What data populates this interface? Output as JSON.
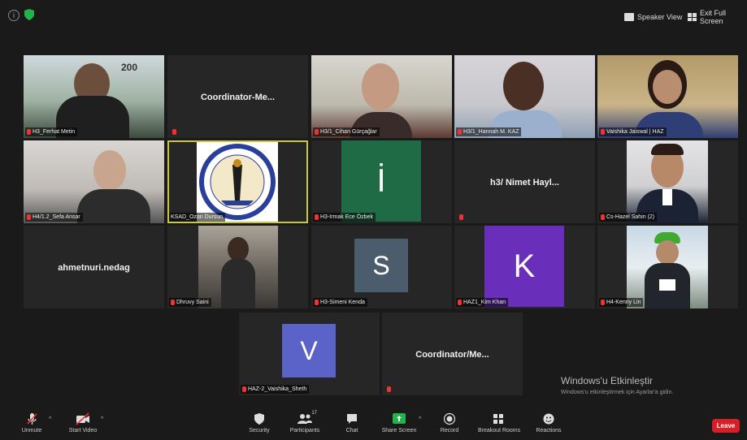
{
  "topbar": {
    "speaker_view": "Speaker View",
    "exit_full_screen": "Exit Full Screen"
  },
  "tiles": [
    {
      "name": "H3_Ferhat Metin",
      "big": "",
      "type": "video"
    },
    {
      "name": "",
      "big": "Coordinator-Me...",
      "type": "name"
    },
    {
      "name": "H3/1_Cihan Gürçağlar",
      "big": "",
      "type": "video"
    },
    {
      "name": "H3/1_Hannah M. KAZ",
      "big": "",
      "type": "video"
    },
    {
      "name": "Vaishika Jaiswal | HAZ",
      "big": "",
      "type": "video"
    },
    {
      "name": "H4/1.2_Sefa Ansar",
      "big": "",
      "type": "video"
    },
    {
      "name": "KSAD_Ozan Dursun",
      "big": "",
      "type": "logo"
    },
    {
      "name": "H3-Irmak Ece Özbek",
      "big": "",
      "type": "avatar",
      "letter": "İ",
      "color": "#1f6b46"
    },
    {
      "name": "",
      "big": "h3/ Nimet Hayl...",
      "type": "name"
    },
    {
      "name": "Cs-Hazel Sahin (2)",
      "big": "",
      "type": "video"
    },
    {
      "name": "",
      "big": "ahmetnuri.nedag",
      "type": "name"
    },
    {
      "name": "Dhruvy Saini",
      "big": "",
      "type": "video"
    },
    {
      "name": "H3-Simeni Kenda",
      "big": "",
      "type": "avatar",
      "letter": "S",
      "color": "#4b5d6c"
    },
    {
      "name": "HAZ1_Kim Khan",
      "big": "",
      "type": "avatar",
      "letter": "K",
      "color": "#6a2fba"
    },
    {
      "name": "H4-Kenny Lin",
      "big": "",
      "type": "video"
    },
    {
      "name": "HAZ-2_Vaishika_Sheth",
      "big": "",
      "type": "avatar",
      "letter": "V",
      "color": "#5b63c8"
    },
    {
      "name": "",
      "big": "Coordinator/Me...",
      "type": "name"
    }
  ],
  "watermark": {
    "title": "Windows'u Etkinleştir",
    "subtitle": "Windows'u etkinleştirmek için Ayarlar'a gidin."
  },
  "toolbar": {
    "unmute": "Unmute",
    "start_video": "Start Video",
    "security": "Security",
    "participants": "Participants",
    "participants_count": "17",
    "chat": "Chat",
    "share_screen": "Share Screen",
    "record": "Record",
    "breakout_rooms": "Breakout Rooms",
    "reactions": "Reactions",
    "leave": "Leave"
  },
  "colors": {
    "active_border": "#c7c83a",
    "share_green": "#23b34b",
    "leave_red": "#d61f26",
    "mute_red": "#e33333"
  }
}
